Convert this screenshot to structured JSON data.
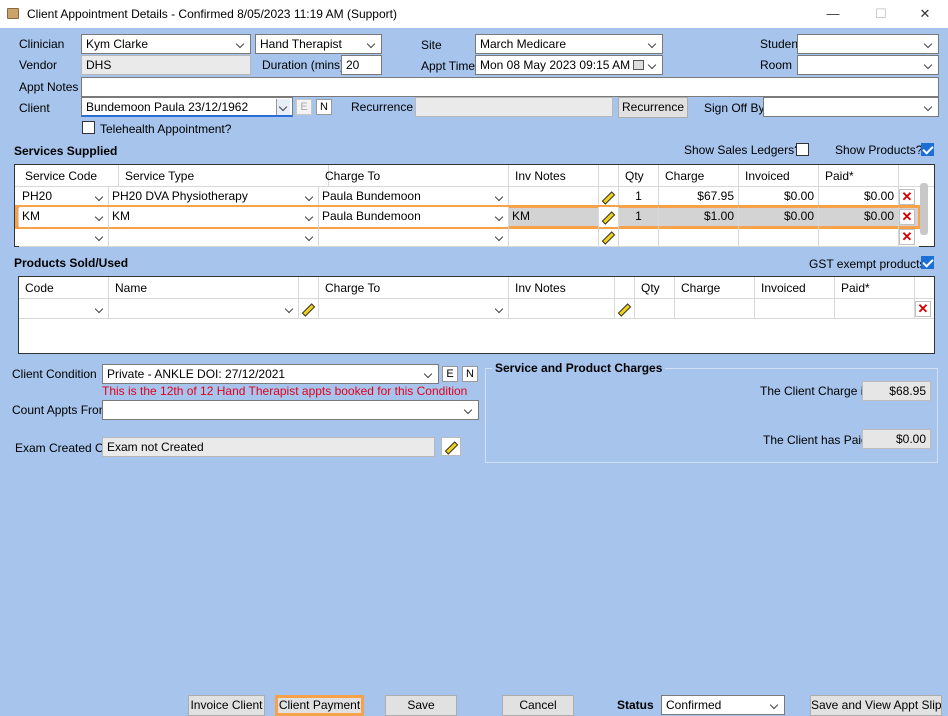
{
  "window": {
    "title": "Client Appointment Details - Confirmed 8/05/2023 11:19 AM (Support)",
    "min": "—",
    "max": "☐",
    "close": "✕"
  },
  "header": {
    "clinician_label": "Clinician",
    "clinician_value": "Kym Clarke",
    "role_value": "Hand Therapist",
    "site_label": "Site",
    "site_value": "March Medicare",
    "student_label": "Student",
    "student_value": "",
    "vendor_label": "Vendor",
    "vendor_value": "DHS",
    "duration_label": "Duration (mins)",
    "duration_value": "20",
    "appt_time_label": "Appt Time",
    "appt_time_value": "Mon 08 May 2023 09:15 AM",
    "room_label": "Room",
    "room_value": "",
    "appt_notes_label": "Appt Notes",
    "appt_notes_value": "",
    "client_label": "Client",
    "client_value": "Bundemoon Paula 23/12/1962",
    "e_button": "E",
    "n_button": "N",
    "recurrence_label": "Recurrence",
    "recurrence_value": "",
    "recurrence_button": "Recurrence",
    "sign_off_label": "Sign Off By",
    "sign_off_value": "",
    "telehealth_label": "Telehealth Appointment?"
  },
  "services": {
    "title": "Services Supplied",
    "show_sales_ledgers_label": "Show Sales Ledgers?",
    "show_products_label": "Show Products?",
    "columns": [
      "Service Code",
      "Service Type",
      "Charge To",
      "Inv Notes",
      "",
      "Qty",
      "Charge",
      "Invoiced",
      "Paid*"
    ],
    "rows": [
      {
        "code": "PH20",
        "type": "PH20 DVA Physiotherapy",
        "charge_to": "Paula Bundemoon",
        "inv_notes": "",
        "qty": "1",
        "charge": "$67.95",
        "invoiced": "$0.00",
        "paid": "$0.00"
      },
      {
        "code": "KM",
        "type": "KM",
        "charge_to": "Paula Bundemoon",
        "inv_notes": "KM",
        "qty": "1",
        "charge": "$1.00",
        "invoiced": "$0.00",
        "paid": "$0.00"
      },
      {
        "code": "",
        "type": "",
        "charge_to": "",
        "inv_notes": "",
        "qty": "",
        "charge": "",
        "invoiced": "",
        "paid": ""
      }
    ]
  },
  "products": {
    "title": "Products Sold/Used",
    "gst_label": "GST exempt products",
    "columns": [
      "Code",
      "Name",
      "",
      "Charge To",
      "Inv Notes",
      "",
      "Qty",
      "Charge",
      "Invoiced",
      "Paid*"
    ]
  },
  "condition": {
    "client_condition_label": "Client Condition",
    "client_condition_value": "Private - ANKLE DOI: 27/12/2021",
    "warning": "This is the 12th of 12 Hand Therapist appts booked for this Condition",
    "count_appts_label": "Count Appts From",
    "count_appts_value": "",
    "exam_label": "Exam Created On",
    "exam_value": "Exam not Created"
  },
  "charges": {
    "title": "Service and Product Charges",
    "client_charge_label": "The Client Charge is",
    "client_charge_value": "$68.95",
    "client_paid_label": "The Client has Paid",
    "client_paid_value": "$0.00"
  },
  "footer": {
    "invoice_client": "Invoice Client",
    "client_payment": "Client Payment",
    "save": "Save",
    "cancel": "Cancel",
    "status_label": "Status",
    "status_value": "Confirmed",
    "save_view": "Save and View Appt Slip"
  },
  "colors": {
    "background": "#a6c4ec",
    "highlight": "#f7a24a",
    "warning": "#e3001b",
    "checkbox": "#1d6fd6"
  }
}
